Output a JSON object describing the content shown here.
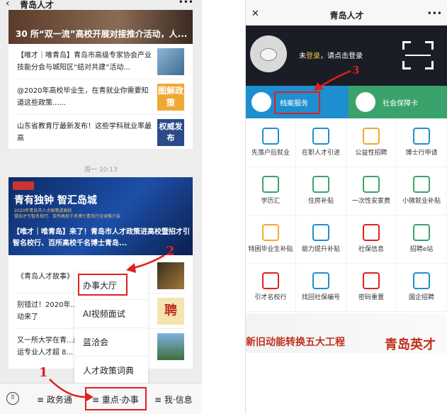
{
  "left": {
    "title": "青岛人才",
    "more": "•••",
    "banner_top": "30 所“双一流”高校开展对接推介活动，人...",
    "articles_top": [
      {
        "text": "【唯才｜唯青岛】青岛市高级专家协会产业技能分会与城阳区“结对共建”活动..."
      },
      {
        "text": "@2020年高校毕业生，在青就业你需要知道这些政策......",
        "thumb": "图解政策"
      },
      {
        "text": "山东省教育厅最新发布！这些学科就业率最高",
        "thumb": "权威发布"
      }
    ],
    "timestamp": "周一 10:13",
    "banner2": {
      "title": "青有独钟 智汇岛城",
      "sub1": "2020年青岛市人才政策进高校",
      "sub2": "暨招才引智名校行、百所高校千名博士青岛行全球推介会",
      "headline": "【唯才｜唯青岛】来了！青岛市人才政策进高校暨招才引智名校行、百所高校千名博士青岛..."
    },
    "articles_bottom": [
      {
        "text": "《青岛人才故事》"
      },
      {
        "text": "别错过！2020年...动来了",
        "thumb": "聘"
      },
      {
        "text": "又一所大学在青...航运专业人才超 8..."
      }
    ],
    "menu": [
      "办事大厅",
      "AI视频面试",
      "蓝洽会",
      "人才政策词典"
    ],
    "bottom": {
      "keyboard_icon": "keyboard-icon",
      "tab1": "≡ 政务通",
      "tab2": "≡ 重点·办事",
      "tab3": "≡ 我·信息"
    },
    "annotations": {
      "one": "1",
      "two": "2"
    }
  },
  "right": {
    "status": "",
    "close": "✕",
    "title": "青岛人才",
    "more": "•••",
    "login_prefix": "未",
    "login_link": "登录",
    "login_suffix": "，请点击登录",
    "tab_archive": "档案服务",
    "tab_social": "社会保障卡",
    "annotation_three": "3",
    "services": [
      "先落户后就业",
      "在职人才引进",
      "公益性招聘",
      "博士行申请",
      "学历汇",
      "住房补贴",
      "一次性安家费",
      "小微就业补贴",
      "特困毕业生补贴",
      "能力提升补贴",
      "社保信息",
      "招聘e站",
      "引才名校行",
      "找回社保编号",
      "密码重置",
      "国企招聘"
    ],
    "footer_left": "新旧动能转换五大工程",
    "footer_right": "青岛英才"
  },
  "colors": {
    "accent": "#e02020",
    "green": "#3aa36b",
    "blue": "#1d8fd0",
    "dark": "#1a1d26"
  }
}
